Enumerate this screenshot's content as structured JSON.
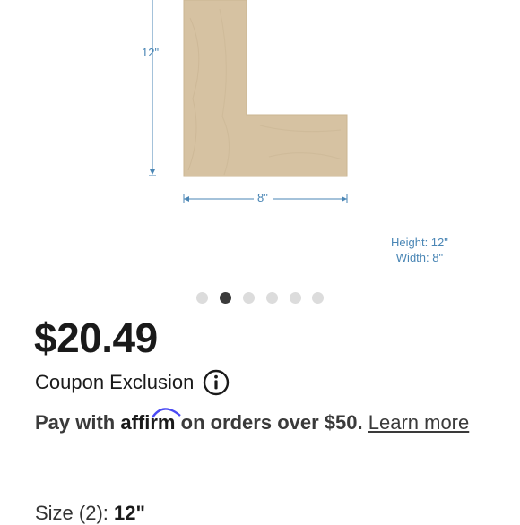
{
  "product_image": {
    "height_label": "12\"",
    "width_label": "8\"",
    "dims_note_height": "Height: 12\"",
    "dims_note_width": "Width: 8\"",
    "wood_color": "#d6c2a2"
  },
  "carousel": {
    "count": 6,
    "active_index": 1
  },
  "price": "$20.49",
  "coupon": {
    "text": "Coupon Exclusion",
    "icon": "info-icon"
  },
  "affirm": {
    "prefix": "Pay with",
    "brand": "affirm",
    "suffix": "on orders over $50.",
    "link": "Learn more"
  },
  "size": {
    "label": "Size (2): ",
    "value": "12\""
  }
}
